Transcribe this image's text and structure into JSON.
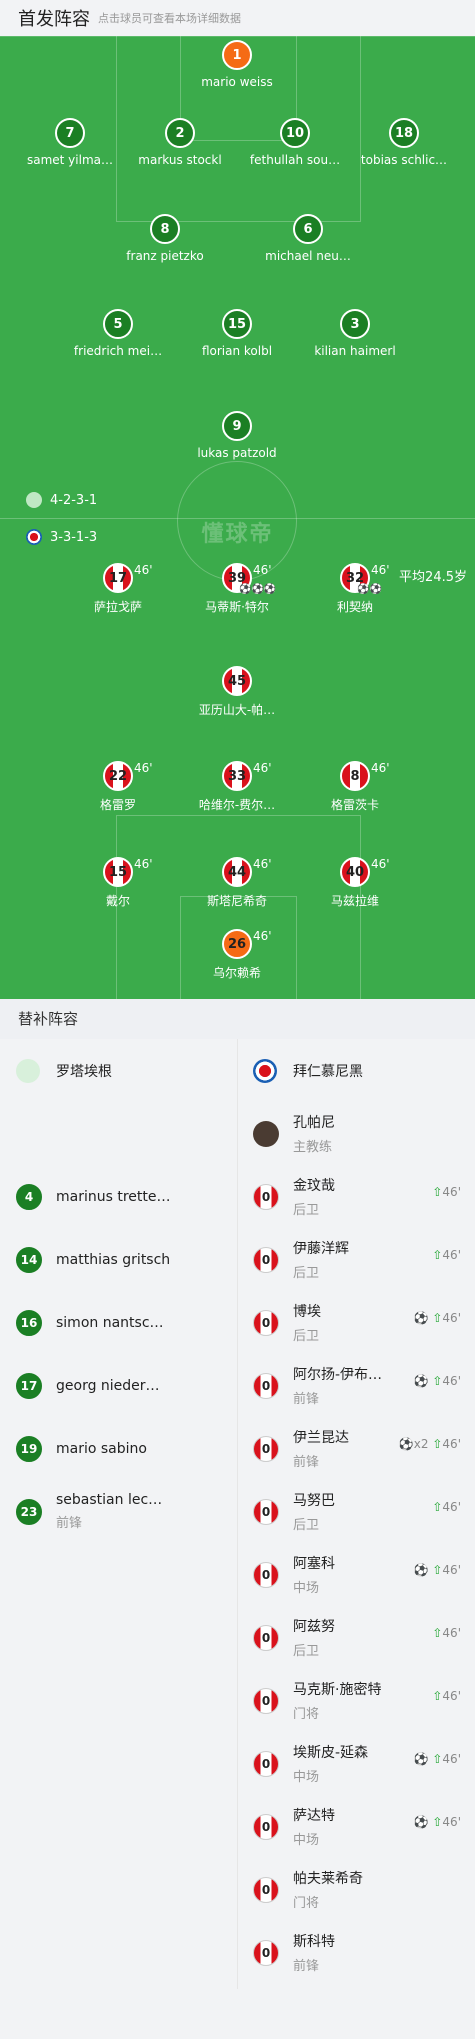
{
  "header": {
    "title": "首发阵容",
    "hint": "点击球员可查看本场详细数据"
  },
  "pitch": {
    "watermark": "懂球帝"
  },
  "home": {
    "formation": "4-2-3-1",
    "players": [
      {
        "number": "1",
        "name": "mario weiss",
        "gk": true
      },
      {
        "number": "7",
        "name": "samet yilma…"
      },
      {
        "number": "2",
        "name": "markus stockl"
      },
      {
        "number": "10",
        "name": "fethullah sou…"
      },
      {
        "number": "18",
        "name": "tobias schlic…",
        "goal": true
      },
      {
        "number": "8",
        "name": "franz pietzko"
      },
      {
        "number": "6",
        "name": "michael neu…"
      },
      {
        "number": "5",
        "name": "friedrich mei…"
      },
      {
        "number": "15",
        "name": "florian kolbl"
      },
      {
        "number": "3",
        "name": "kilian haimerl"
      },
      {
        "number": "9",
        "name": "lukas patzold"
      }
    ]
  },
  "away": {
    "formation": "3-3-1-3",
    "avg_age": "平均24.5岁",
    "players": [
      {
        "number": "17",
        "name": "萨拉戈萨",
        "sub": "46'"
      },
      {
        "number": "39",
        "name": "马蒂斯·特尔",
        "sub": "46'",
        "balls": "⚽⚽⚽"
      },
      {
        "number": "32",
        "name": "利契纳",
        "sub": "46'",
        "balls": "⚽⚽"
      },
      {
        "number": "45",
        "name": "亚历山大-帕…"
      },
      {
        "number": "22",
        "name": "格雷罗",
        "sub": "46'",
        "ball1": true
      },
      {
        "number": "33",
        "name": "哈维尔-费尔…",
        "sub": "46'"
      },
      {
        "number": "8",
        "name": "格雷茨卡",
        "sub": "46'"
      },
      {
        "number": "15",
        "name": "戴尔",
        "sub": "46'"
      },
      {
        "number": "44",
        "name": "斯塔尼希奇",
        "sub": "46'"
      },
      {
        "number": "40",
        "name": "马兹拉维",
        "sub": "46'",
        "ball1": true
      },
      {
        "number": "26",
        "name": "乌尔赖希",
        "sub": "46'",
        "gk": true
      }
    ]
  },
  "subs": {
    "title": "替补阵容",
    "home_team": "罗塔埃根",
    "away_team": "拜仁慕尼黑",
    "coach": {
      "name": "孔帕尼",
      "role": "主教练"
    },
    "home_list": [
      {
        "number": "4",
        "name": "marinus trette…",
        "pos": ""
      },
      {
        "number": "14",
        "name": "matthias gritsch",
        "pos": ""
      },
      {
        "number": "16",
        "name": "simon nantsc…",
        "pos": ""
      },
      {
        "number": "17",
        "name": "georg nieder…",
        "pos": ""
      },
      {
        "number": "19",
        "name": "mario sabino",
        "pos": ""
      },
      {
        "number": "23",
        "name": "sebastian lec…",
        "pos": "前锋"
      }
    ],
    "away_list": [
      {
        "number": "0",
        "name": "金玟哉",
        "pos": "后卫",
        "goals": "",
        "min": "46'"
      },
      {
        "number": "0",
        "name": "伊藤洋辉",
        "pos": "后卫",
        "goals": "",
        "min": "46'"
      },
      {
        "number": "0",
        "name": "博埃",
        "pos": "后卫",
        "goals": "⚽",
        "min": "46'"
      },
      {
        "number": "0",
        "name": "阿尔扬-伊布…",
        "pos": "前锋",
        "goals": "⚽",
        "min": "46'"
      },
      {
        "number": "0",
        "name": "伊兰昆达",
        "pos": "前锋",
        "goals": "⚽x2",
        "min": "46'"
      },
      {
        "number": "0",
        "name": "马努巴",
        "pos": "后卫",
        "goals": "",
        "min": "46'"
      },
      {
        "number": "0",
        "name": "阿塞科",
        "pos": "中场",
        "goals": "⚽",
        "min": "46'"
      },
      {
        "number": "0",
        "name": "阿兹努",
        "pos": "后卫",
        "goals": "",
        "min": "46'"
      },
      {
        "number": "0",
        "name": "马克斯·施密特",
        "pos": "门将",
        "goals": "",
        "min": "46'"
      },
      {
        "number": "0",
        "name": "埃斯皮-延森",
        "pos": "中场",
        "goals": "⚽",
        "min": "46'"
      },
      {
        "number": "0",
        "name": "萨达特",
        "pos": "中场",
        "goals": "⚽",
        "min": "46'"
      },
      {
        "number": "0",
        "name": "帕夫莱希奇",
        "pos": "门将",
        "goals": "",
        "min": ""
      },
      {
        "number": "0",
        "name": "斯科特",
        "pos": "前锋",
        "goals": "",
        "min": ""
      }
    ]
  },
  "colors": {
    "pitch": "#3bab4b",
    "home": "#1b7f24",
    "away_red": "#d9121c",
    "gk": "#f56b15"
  }
}
